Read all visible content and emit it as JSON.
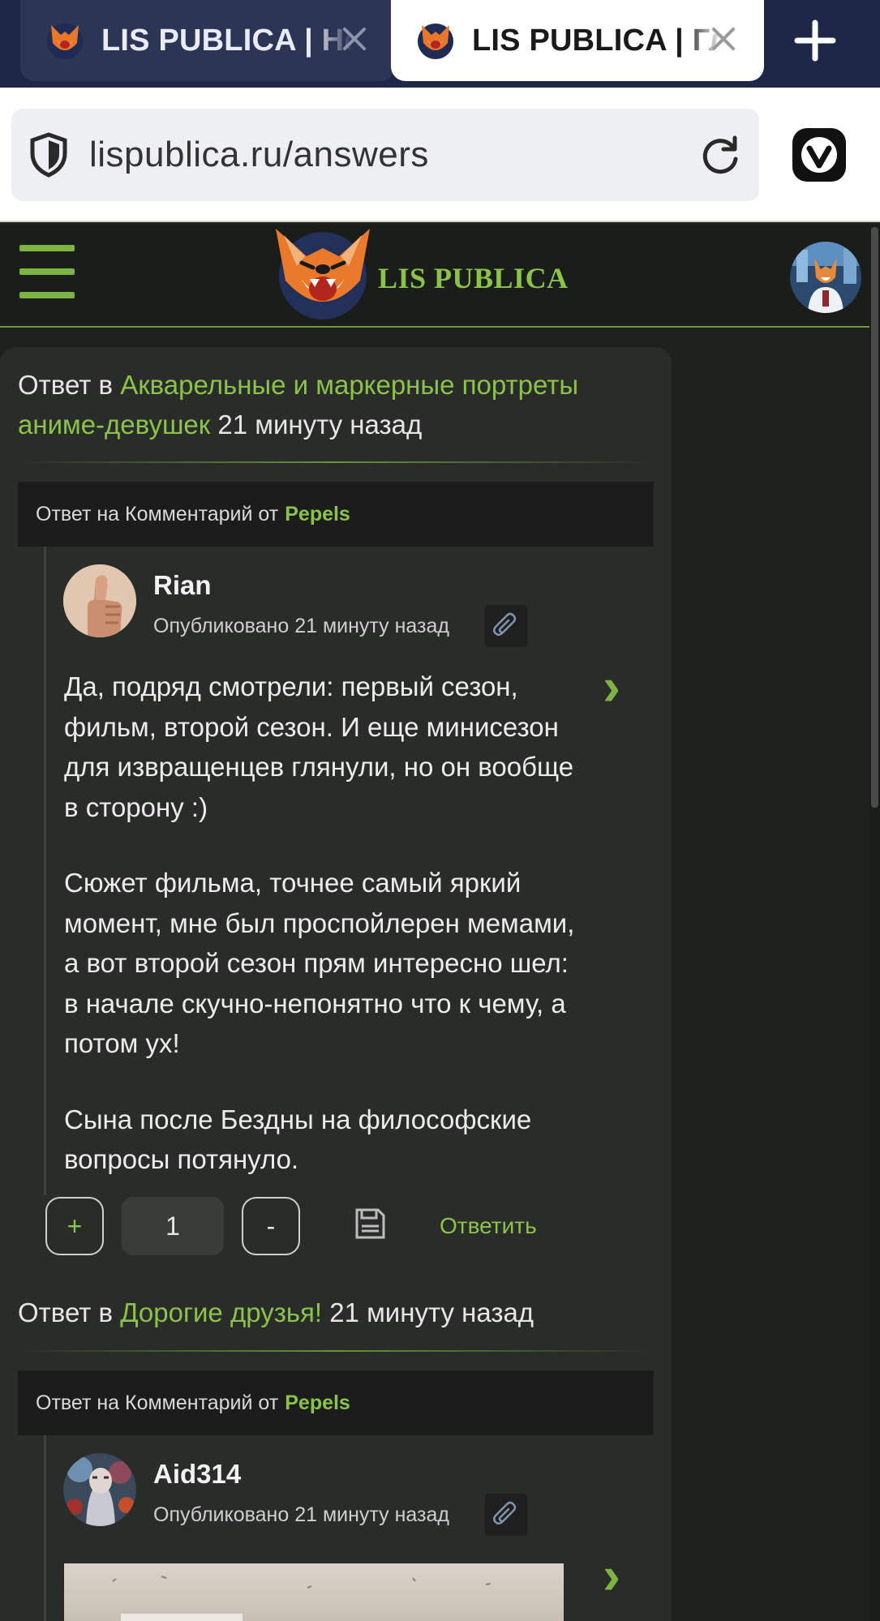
{
  "browser": {
    "tabs": [
      {
        "title": "LIS PUBLICA | Но",
        "state": "inactive"
      },
      {
        "title": "LIS PUBLICA | Гл",
        "state": "active"
      }
    ],
    "url": "lispublica.ru/answers",
    "icons": {
      "shield": "shield-icon",
      "reload": "reload-icon",
      "browser_menu": "vivaldi-icon",
      "new_tab": "plus-icon",
      "close_tab": "close-icon"
    }
  },
  "site": {
    "brand": "LIS PUBLICA",
    "accent_color": "#8bc34a",
    "background_color": "#1f211f"
  },
  "feed": [
    {
      "prefix": "Ответ в",
      "topic": "Акварельные и маркерные портреты аниме-девушек",
      "time": "21 минуту назад",
      "reply_to_label": "Ответ на Комментарий от",
      "reply_to_user": "Pepels",
      "author": "Rian",
      "published": "Опубликовано 21 минуту назад",
      "paragraphs": [
        "Да, подряд смотрели: первый сезон, фильм, второй сезон. И еще минисезон для извращенцев глянули, но он вообще в сторону :)",
        "Сюжет фильма, точнее самый яркий момент, мне был проспойлерен мемами, а вот второй сезон прям интересно шел: в начале скучно-непонятно что к чему, а потом ух!",
        "Сына после Бездны на философские вопросы потянуло."
      ],
      "vote_plus": "+",
      "votes": "1",
      "vote_minus": "-",
      "reply_label": "Ответить"
    },
    {
      "prefix": "Ответ в",
      "topic": "Дорогие друзья!",
      "time": "21 минуту назад",
      "reply_to_label": "Ответ на Комментарий от",
      "reply_to_user": "Pepels",
      "author": "Aid314",
      "published": "Опубликовано 21 минуту назад"
    }
  ]
}
